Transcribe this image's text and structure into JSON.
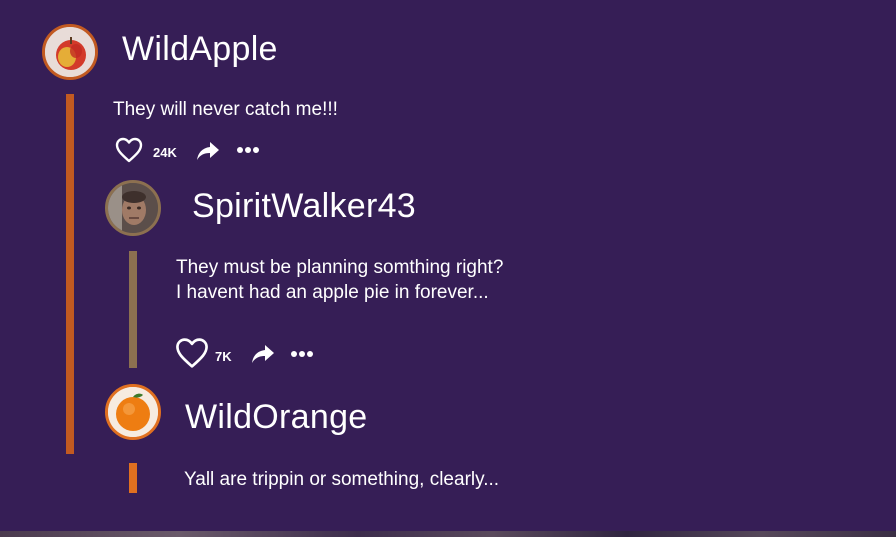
{
  "comments": [
    {
      "username": "WildApple",
      "text": "They will never catch me!!!",
      "likes": "24K",
      "avatar_icon": "apple-avatar",
      "thread_color": "#c25a21",
      "ring_color": "#c25a21"
    },
    {
      "username": "SpiritWalker43",
      "text_line1": "They must be planning somthing right?",
      "text_line2": "I havent had an apple pie in forever...",
      "likes": "7K",
      "avatar_icon": "man-face-avatar",
      "thread_color": "#8c7050",
      "ring_color": "#8c7050"
    },
    {
      "username": "WildOrange",
      "text": "Yall are trippin or something, clearly...",
      "avatar_icon": "orange-avatar",
      "thread_color": "#e07020",
      "ring_color": "#e07020"
    }
  ],
  "icons": {
    "like": "heart-icon",
    "share": "share-arrow-icon",
    "more": "more-dots-icon"
  },
  "colors": {
    "background": "#361e56",
    "text": "#ffffff"
  }
}
